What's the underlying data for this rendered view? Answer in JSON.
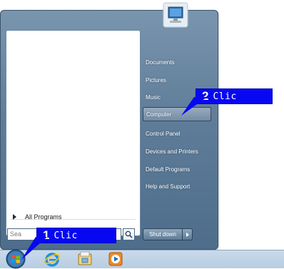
{
  "start_menu": {
    "all_programs_label": "All Programs",
    "search_placeholder": "Sea",
    "shutdown_label": "Shut down",
    "right_items": [
      {
        "label": "Documents"
      },
      {
        "label": "Pictures"
      },
      {
        "label": "Music"
      },
      {
        "label": "Computer",
        "selected": true
      },
      {
        "label": "Control Panel"
      },
      {
        "label": "Devices and Printers"
      },
      {
        "label": "Default Programs"
      },
      {
        "label": "Help and Support"
      }
    ]
  },
  "callouts": [
    {
      "number": "1",
      "text": "Clic"
    },
    {
      "number": "2",
      "text": "Clic"
    }
  ],
  "taskbar": {
    "icons": [
      "start-orb-icon",
      "internet-explorer-icon",
      "file-explorer-icon",
      "media-player-icon"
    ]
  }
}
